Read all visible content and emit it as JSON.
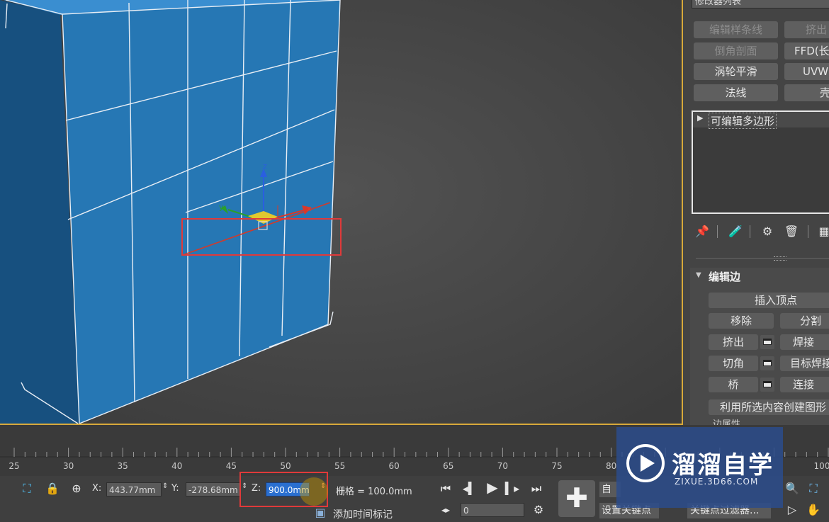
{
  "viewport": {
    "gizmo_axes": {
      "x": "x",
      "y": "y",
      "z": "z"
    }
  },
  "command_panel": {
    "modifier_list_label": "修改器列表",
    "modifier_buttons": [
      {
        "label": "编辑样条线",
        "enabled": false
      },
      {
        "label": "挤出",
        "enabled": false
      },
      {
        "label": "倒角剖面",
        "enabled": false
      },
      {
        "label": "FFD(长",
        "enabled": true
      },
      {
        "label": "涡轮平滑",
        "enabled": true
      },
      {
        "label": "UVW 贴",
        "enabled": true
      },
      {
        "label": "法线",
        "enabled": true
      },
      {
        "label": "壳",
        "enabled": true
      }
    ],
    "stack_item": "可编辑多边形",
    "edit_edges": {
      "title": "编辑边",
      "insert_vertex": "插入顶点",
      "remove": "移除",
      "split": "分割",
      "extrude": "挤出",
      "weld": "焊接",
      "chamfer": "切角",
      "target_weld": "目标焊接",
      "bridge": "桥",
      "connect": "连接",
      "create_shape": "利用所选内容创建图形",
      "cut_off": "边属性"
    }
  },
  "timeline": {
    "ticks": [
      "25",
      "30",
      "35",
      "40",
      "45",
      "50",
      "55",
      "60",
      "65",
      "70",
      "75",
      "80",
      "100"
    ]
  },
  "statusbar": {
    "x_label": "X:",
    "x_value": "443.77mm",
    "y_label": "Y:",
    "y_value": "-278.68mm",
    "z_label": "Z:",
    "z_value": "900.0mm",
    "grid_label": "栅格 = 100.0mm",
    "add_time_tag": "添加时间标记",
    "frame_value": "0",
    "auto_key": "自动",
    "set_key": "设置关键点",
    "key_filters": "关键点过滤器..."
  },
  "watermark": {
    "brand": "溜溜自学",
    "url": "ZIXUE.3D66.COM"
  },
  "colors": {
    "box_front": "#2677b4",
    "box_side": "#1a5484",
    "viewport_border": "#d8a93a",
    "highlight_red": "#e03a3a",
    "watermark_bg": "#2c4c8c"
  }
}
